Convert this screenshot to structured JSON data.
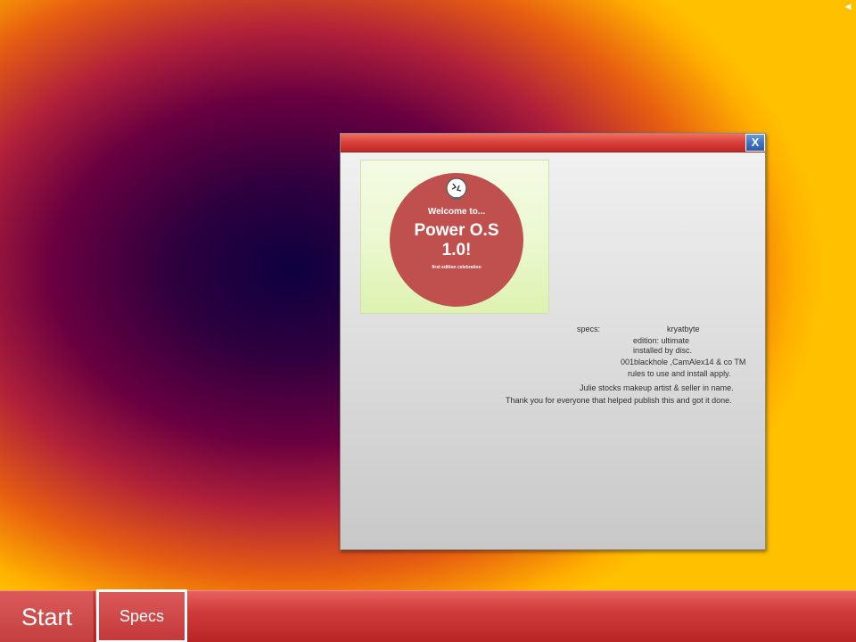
{
  "desktop": {
    "speaker_icon": "speaker-icon"
  },
  "window": {
    "close_label": "X",
    "welcome_image": {
      "welcome_text": "Welcome to...",
      "title_line1": "Power O.S",
      "title_line2": "1.0!",
      "subtitle": "first edition celebration"
    },
    "specs": {
      "label": "specs:",
      "brand": "kryatbyte",
      "edition": "edition: ultimate",
      "install": "installed by disc.",
      "credits": "001blackhole ,CamAlex14 & co TM",
      "rules": "rules to use and install apply.",
      "makeup": "Julie stocks makeup artist & seller in name.",
      "thanks": "Thank you for everyone that helped publish this and got it done."
    }
  },
  "taskbar": {
    "start_label": "Start",
    "specs_label": "Specs"
  },
  "colors": {
    "taskbar_red": "#d03a3a",
    "close_blue": "#3b6fc0",
    "logo_red": "#c0504d",
    "image_green": "#ecf8d2"
  }
}
